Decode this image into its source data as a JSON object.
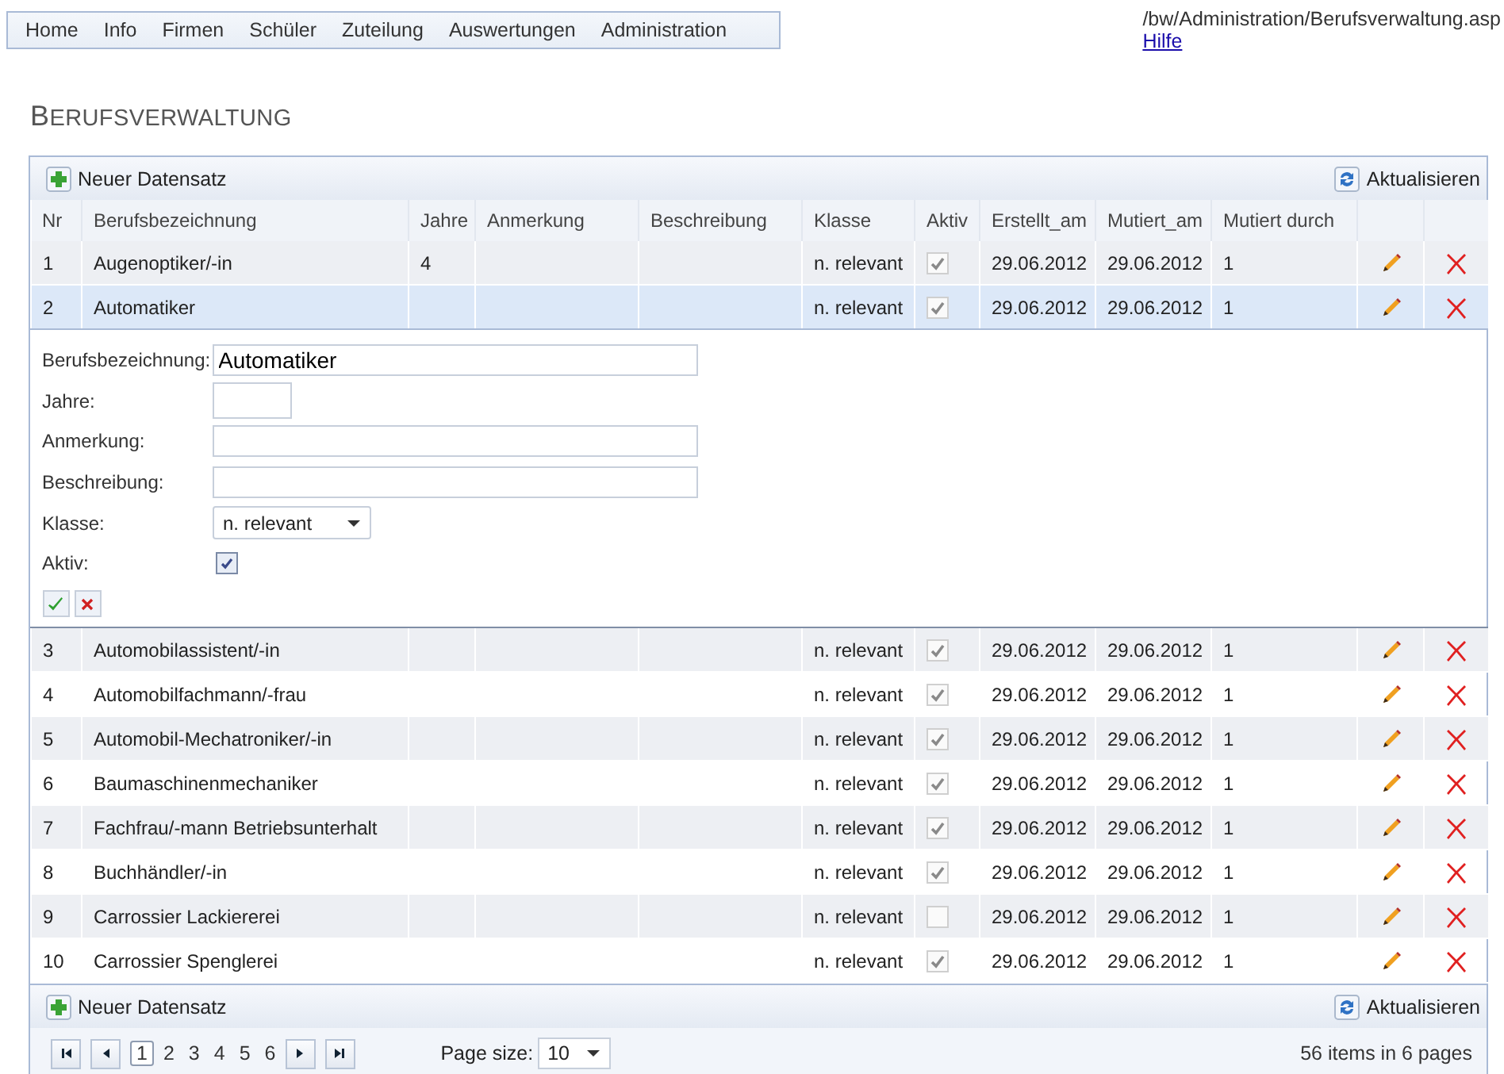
{
  "nav": [
    "Home",
    "Info",
    "Firmen",
    "Schüler",
    "Zuteilung",
    "Auswertungen",
    "Administration"
  ],
  "path": "/bw/Administration/Berufsverwaltung.asp",
  "help_link": "Hilfe",
  "page_title": "BERUFSVERWALTUNG",
  "top_toolbar": {
    "new_label": "Neuer Datensatz",
    "refresh_label": "Aktualisieren"
  },
  "columns": [
    "Nr",
    "Berufsbezeichnung",
    "Jahre",
    "Anmerkung",
    "Beschreibung",
    "Klasse",
    "Aktiv",
    "Erstellt_am",
    "Mutiert_am",
    "Mutiert durch"
  ],
  "rows": [
    {
      "nr": "1",
      "name": "Augenoptiker/-in",
      "years": "4",
      "klasse": "n. relevant",
      "active": true,
      "created": "29.06.2012",
      "modified": "29.06.2012",
      "by": "1",
      "selected": false
    },
    {
      "nr": "2",
      "name": "Automatiker",
      "years": "",
      "klasse": "n. relevant",
      "active": true,
      "created": "29.06.2012",
      "modified": "29.06.2012",
      "by": "1",
      "selected": true
    },
    {
      "nr": "3",
      "name": "Automobilassistent/-in",
      "years": "",
      "klasse": "n. relevant",
      "active": true,
      "created": "29.06.2012",
      "modified": "29.06.2012",
      "by": "1",
      "selected": false
    },
    {
      "nr": "4",
      "name": "Automobilfachmann/-frau",
      "years": "",
      "klasse": "n. relevant",
      "active": true,
      "created": "29.06.2012",
      "modified": "29.06.2012",
      "by": "1",
      "selected": false
    },
    {
      "nr": "5",
      "name": "Automobil-Mechatroniker/-in",
      "years": "",
      "klasse": "n. relevant",
      "active": true,
      "created": "29.06.2012",
      "modified": "29.06.2012",
      "by": "1",
      "selected": false
    },
    {
      "nr": "6",
      "name": "Baumaschinenmechaniker",
      "years": "",
      "klasse": "n. relevant",
      "active": true,
      "created": "29.06.2012",
      "modified": "29.06.2012",
      "by": "1",
      "selected": false
    },
    {
      "nr": "7",
      "name": "Fachfrau/-mann Betriebsunterhalt",
      "years": "",
      "klasse": "n. relevant",
      "active": true,
      "created": "29.06.2012",
      "modified": "29.06.2012",
      "by": "1",
      "selected": false
    },
    {
      "nr": "8",
      "name": "Buchhändler/-in",
      "years": "",
      "klasse": "n. relevant",
      "active": true,
      "created": "29.06.2012",
      "modified": "29.06.2012",
      "by": "1",
      "selected": false
    },
    {
      "nr": "9",
      "name": "Carrossier Lackiererei",
      "years": "",
      "klasse": "n. relevant",
      "active": false,
      "created": "29.06.2012",
      "modified": "29.06.2012",
      "by": "1",
      "selected": false
    },
    {
      "nr": "10",
      "name": "Carrossier Spenglerei",
      "years": "",
      "klasse": "n. relevant",
      "active": true,
      "created": "29.06.2012",
      "modified": "29.06.2012",
      "by": "1",
      "selected": false
    }
  ],
  "edit_form": {
    "fields": [
      {
        "label": "Berufsbezeichnung:",
        "kind": "text",
        "value": "Automatiker"
      },
      {
        "label": "Jahre:",
        "kind": "short"
      },
      {
        "label": "Anmerkung:",
        "kind": "text"
      },
      {
        "label": "Beschreibung:",
        "kind": "text"
      },
      {
        "label": "Klasse:",
        "kind": "select",
        "value": "n. relevant"
      },
      {
        "label": "Aktiv:",
        "kind": "checkbox",
        "checked": true
      }
    ]
  },
  "bottom_toolbar": {
    "new_label": "Neuer Datensatz",
    "refresh_label": "Aktualisieren"
  },
  "pager": {
    "pages": [
      {
        "label": "1",
        "selected": true
      },
      {
        "label": "2",
        "selected": false
      },
      {
        "label": "3",
        "selected": false
      },
      {
        "label": "4",
        "selected": false
      },
      {
        "label": "5",
        "selected": false
      },
      {
        "label": "6",
        "selected": false
      }
    ],
    "page_size_label": "Page size:",
    "page_size": "10",
    "summary": "56 items in 6 pages"
  }
}
